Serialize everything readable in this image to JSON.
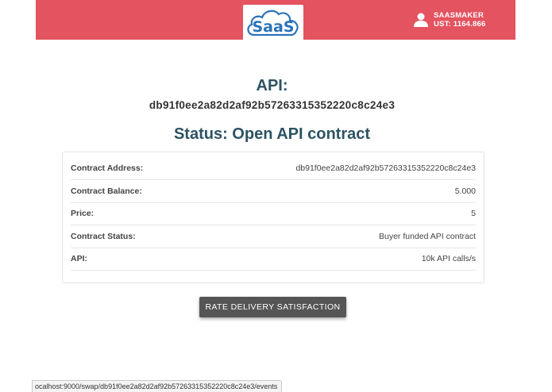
{
  "header": {
    "logo_text": "SaaS",
    "user": {
      "name": "SAASMAKER",
      "balance": "UST: 1164.866",
      "icon": "user-icon"
    },
    "colors": {
      "background": "#e35360",
      "logo": "#2a73b8"
    }
  },
  "main": {
    "api_heading": "API:",
    "api_hash": "db91f0ee2a82d2af92b57263315352220c8c24e3",
    "status_heading": "Status: Open API contract"
  },
  "contract": {
    "rows": [
      {
        "label": "Contract Address:",
        "value": "db91f0ee2a82d2af92b57263315352220c8c24e3"
      },
      {
        "label": "Contract Balance:",
        "value": "5.000"
      },
      {
        "label": "Price:",
        "value": "5"
      },
      {
        "label": "Contract Status:",
        "value": "Buyer funded API contract"
      },
      {
        "label": "API:",
        "value": "10k API calls/s"
      }
    ]
  },
  "actions": {
    "rate_delivery": "RATE DELIVERY SATISFACTION"
  },
  "statusbar": {
    "url": "ocalhost:9000/swap/db91f0ee2a82d2af92b57263315352220c8c24e3/events"
  }
}
